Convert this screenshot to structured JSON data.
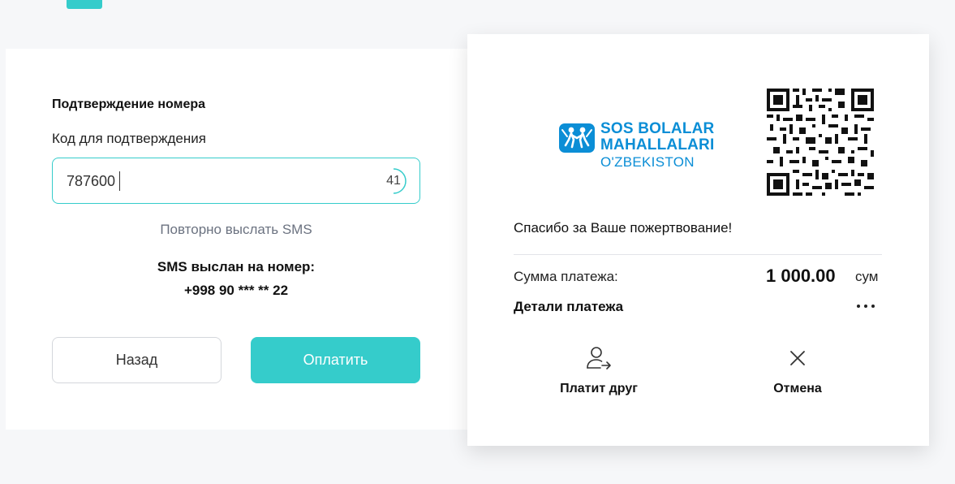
{
  "verification": {
    "title": "Подтверждение номера",
    "code_label": "Код для подтверждения",
    "code_value": "787600",
    "timer": "41",
    "resend_link": "Повторно выслать SMS",
    "sms_sent_label": "SMS выслан на номер:",
    "phone": "+998 90 *** ** 22",
    "back_button": "Назад",
    "pay_button": "Оплатить"
  },
  "receipt": {
    "logo": {
      "line1": "SOS BOLALAR",
      "line2": "MAHALLALARI",
      "line3": "O'ZBEKISTON"
    },
    "thanks": "Спасибо за Ваше пожертвование!",
    "sum_label": "Сумма платежа:",
    "sum_value": "1 000.00",
    "currency": "сум",
    "details_label": "Детали платежа",
    "actions": {
      "friend_pays": "Платит друг",
      "cancel": "Отмена"
    }
  },
  "colors": {
    "accent": "#35cccb",
    "logo_blue": "#0b8ed6",
    "background": "#f6f7f9"
  },
  "icons": {
    "timer": "countdown-ring-icon",
    "more": "more-horizontal-icon",
    "friend": "user-arrow-icon",
    "cancel": "close-icon",
    "qr": "qr-code-icon"
  }
}
